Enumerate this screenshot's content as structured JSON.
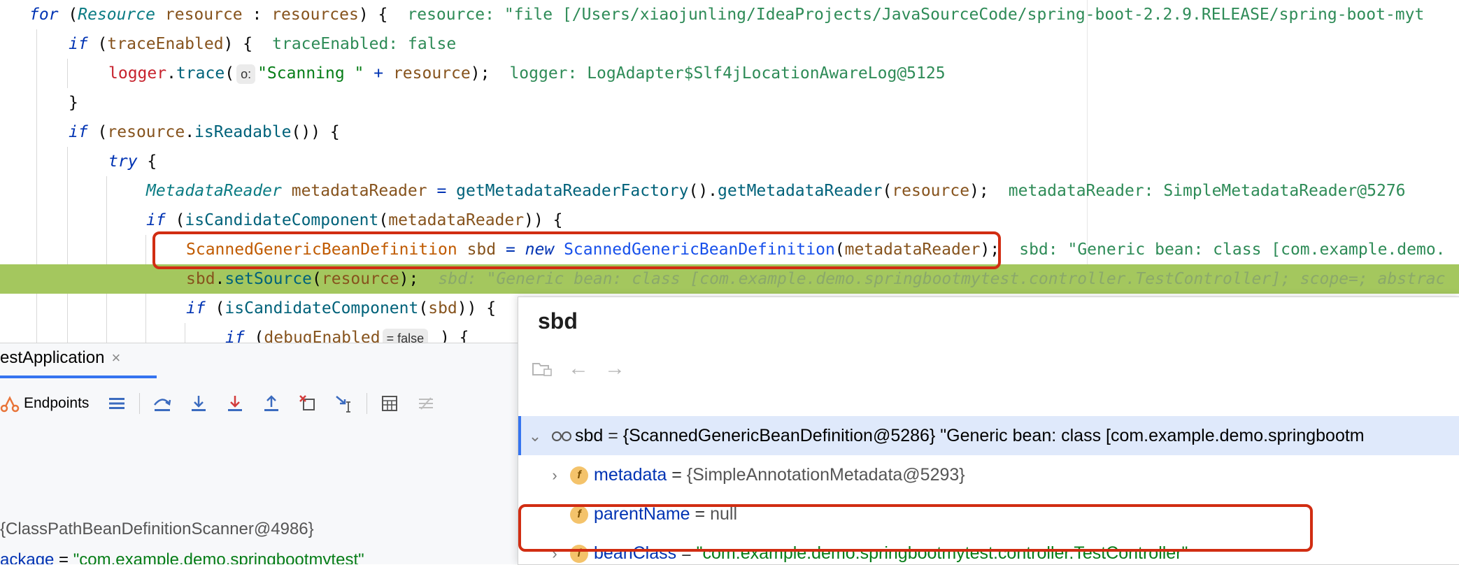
{
  "editor": {
    "line1": {
      "for_kw": "for",
      "open": " (",
      "type": "Resource",
      "name": " resource",
      "colon": " : ",
      "coll": "resources",
      "close": ") {",
      "inline": "resource: \"file [/Users/xiaojunling/IdeaProjects/JavaSourceCode/spring-boot-2.2.9.RELEASE/spring-boot-myt"
    },
    "line2": {
      "if_kw": "if",
      "open": " (",
      "name": "traceEnabled",
      "close": ") {",
      "inline": "traceEnabled: false"
    },
    "line3": {
      "obj": "logger",
      "dot": ".",
      "method": "trace",
      "open": "(",
      "hint": "o:",
      "str": "\"Scanning \"",
      "plus": " + ",
      "arg": "resource",
      "close": ");",
      "inline": "logger: LogAdapter$Slf4jLocationAwareLog@5125"
    },
    "line4": {
      "text": "}"
    },
    "line5": {
      "if_kw": "if",
      "open": " (",
      "obj": "resource",
      "dot": ".",
      "method": "isReadable",
      "close": "()) {"
    },
    "line6": {
      "try_kw": "try",
      "brace": " {"
    },
    "line7": {
      "type": "MetadataReader",
      "name": " metadataReader",
      "eq": " = ",
      "m1": "getMetadataReaderFactory",
      "mid": "().",
      "m2": "getMetadataReader",
      "open": "(",
      "arg": "resource",
      "close": ");",
      "inline": "metadataReader: SimpleMetadataReader@5276"
    },
    "line8": {
      "if_kw": "if",
      "open": " (",
      "method": "isCandidateComponent",
      "p": "(",
      "arg": "metadataReader",
      "close": ")) {"
    },
    "line9": {
      "type": "ScannedGenericBeanDefinition",
      "name": " sbd",
      "eq": " = ",
      "new_kw": "new",
      "ctor": " ScannedGenericBeanDefinition",
      "open": "(",
      "arg": "metadataReader",
      "close": ");",
      "inline": "sbd: \"Generic bean: class [com.example.demo."
    },
    "line10": {
      "obj": "sbd",
      "dot": ".",
      "method": "setSource",
      "open": "(",
      "arg": "resource",
      "close": ");",
      "inline": "sbd: \"Generic bean: class [com.example.demo.springbootmytest.controller.TestController]; scope=; abstrac"
    },
    "line11": {
      "if_kw": "if",
      "open": " (",
      "method": "isCandidateComponent",
      "p": "(",
      "arg": "sbd",
      "close": ")) {"
    },
    "line12": {
      "if_kw": "if",
      "open": " (",
      "name": "debugEnabled",
      "hint": "= false",
      "close": " ) {"
    }
  },
  "debug": {
    "tab_label": "estApplication",
    "tab_close": "×",
    "endpoints_label": "Endpoints",
    "vars": [
      {
        "text": "{ClassPathBeanDefinitionScanner@4986}"
      },
      {
        "name": "ackage",
        "eq": " = ",
        "value": "\"com.example.demo.springbootmytest\""
      }
    ]
  },
  "popup": {
    "title": "sbd",
    "rows": [
      {
        "name": "sbd",
        "eq": " = ",
        "value": "{ScannedGenericBeanDefinition@5286} \"Generic bean: class [com.example.demo.springbootm"
      },
      {
        "name": "metadata",
        "eq": " = ",
        "value": "{SimpleAnnotationMetadata@5293}"
      },
      {
        "name": "parentName",
        "eq": " = ",
        "value": "null"
      },
      {
        "name": "beanClass",
        "eq": " = ",
        "value": "\"com.example.demo.springbootmytest.controller.TestController\""
      }
    ]
  },
  "icons": {
    "field_icon": "f",
    "back_arrow": "←",
    "forward_arrow": "→",
    "chevron_right": "›",
    "chevron_down": "⌄"
  },
  "colors": {
    "execution_line": "#a4c75e",
    "highlight_box": "#d12d12",
    "keyword": "#0033b3",
    "string": "#067d17",
    "inline_value": "#2e8b57"
  }
}
